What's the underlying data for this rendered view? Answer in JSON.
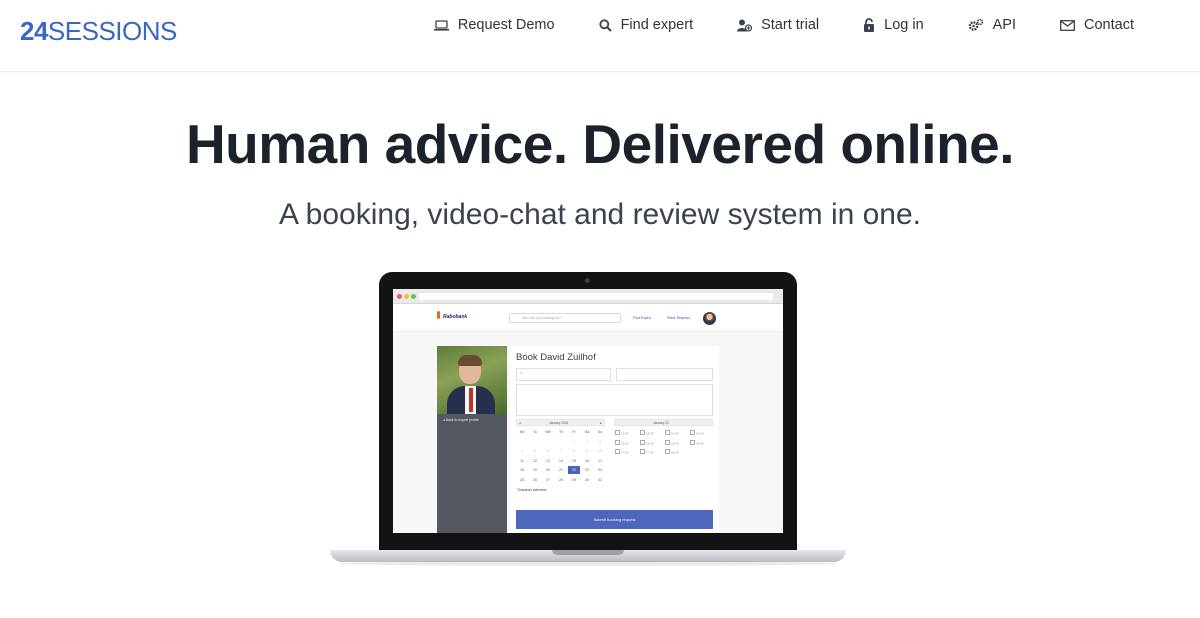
{
  "header": {
    "logo_number": "24",
    "logo_word": "SESSIONS",
    "nav": [
      {
        "icon": "laptop-icon",
        "label": "Request Demo"
      },
      {
        "icon": "search-icon",
        "label": "Find expert"
      },
      {
        "icon": "user-plus-icon",
        "label": "Start trial"
      },
      {
        "icon": "lock-icon",
        "label": "Log in"
      },
      {
        "icon": "gears-icon",
        "label": "API"
      },
      {
        "icon": "envelope-icon",
        "label": "Contact"
      }
    ]
  },
  "hero": {
    "headline": "Human advice. Delivered online.",
    "subheadline": "A booking, video-chat and review system in one."
  },
  "mockup": {
    "bank_name": "Rabobank",
    "search_placeholder": "Who are you looking for?",
    "links": [
      "Find Expert",
      "Place Request"
    ],
    "back_link": "Back to expert profile",
    "booking_title": "Book David Zuilhof",
    "name_placeholder": "Sc",
    "calendar_left_title": "January 2016",
    "calendar_right_title": "January 22",
    "weekdays": [
      "Mo",
      "Tu",
      "We",
      "Th",
      "Fr",
      "Sa",
      "Su"
    ],
    "days": [
      [
        "",
        "",
        "",
        "",
        "1",
        "2",
        "3"
      ],
      [
        "4",
        "5",
        "6",
        "7",
        "8",
        "9",
        "10"
      ],
      [
        "11",
        "12",
        "13",
        "14",
        "15",
        "16",
        "17"
      ],
      [
        "18",
        "19",
        "20",
        "21",
        "22",
        "23",
        "24"
      ],
      [
        "25",
        "26",
        "27",
        "28",
        "29",
        "30",
        "31"
      ]
    ],
    "selected_day": "22",
    "timeslots": [
      [
        "13:00",
        "13:30",
        "14:00",
        "14:30"
      ],
      [
        "15:00",
        "15:30",
        "16:00",
        "16:30"
      ],
      [
        "17:00",
        "17:30",
        "18:00",
        ""
      ]
    ],
    "timeslots_label": "Timeslots selected:",
    "submit_label": "Submit booking request"
  },
  "colors": {
    "brand_blue": "#3b67c4",
    "submit_blue": "#4f66bd",
    "headline": "#1c222b"
  }
}
